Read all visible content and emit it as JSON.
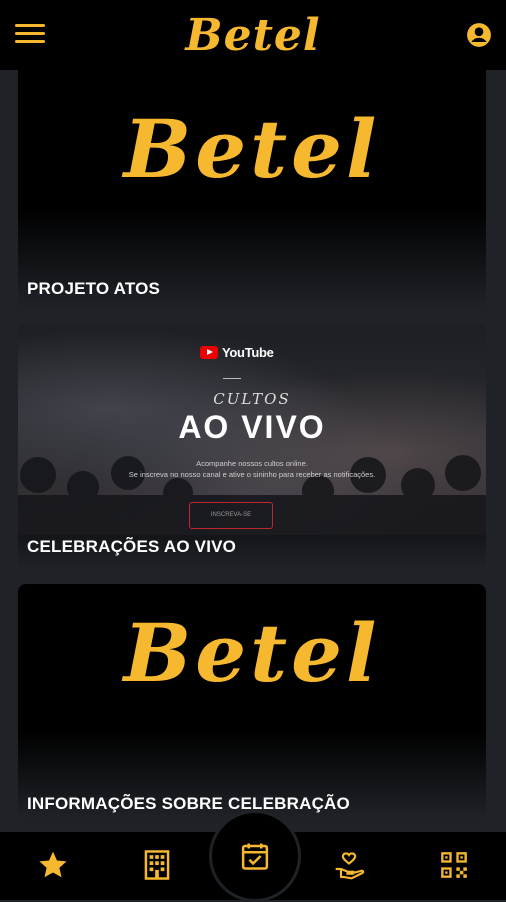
{
  "colors": {
    "accent": "#f5b82e",
    "background": "#1f2328",
    "bar": "#000000"
  },
  "header": {
    "logo_text": "Betel",
    "menu_icon": "hamburger-menu-icon",
    "account_icon": "account-circle-icon"
  },
  "cards": [
    {
      "logo_text": "Betel",
      "title": "PROJETO ATOS"
    },
    {
      "title": "CELEBRAÇÕES AO VIVO",
      "banner": {
        "brand": "YouTube",
        "kicker": "CULTOS",
        "headline": "AO VIVO",
        "line1": "Acompanhe nossos cultos online.",
        "line2": "Se inscreva no nosso canal e ative o sininho para receber as notificações.",
        "button": "INSCREVA-SE"
      }
    },
    {
      "logo_text": "Betel",
      "title": "INFORMAÇÕES SOBRE CELEBRAÇÃO"
    }
  ],
  "bottom_nav": {
    "items": [
      {
        "icon": "star-icon"
      },
      {
        "icon": "building-icon"
      },
      {
        "icon": "calendar-check-icon"
      },
      {
        "icon": "hand-heart-icon"
      },
      {
        "icon": "qr-code-icon"
      }
    ]
  }
}
